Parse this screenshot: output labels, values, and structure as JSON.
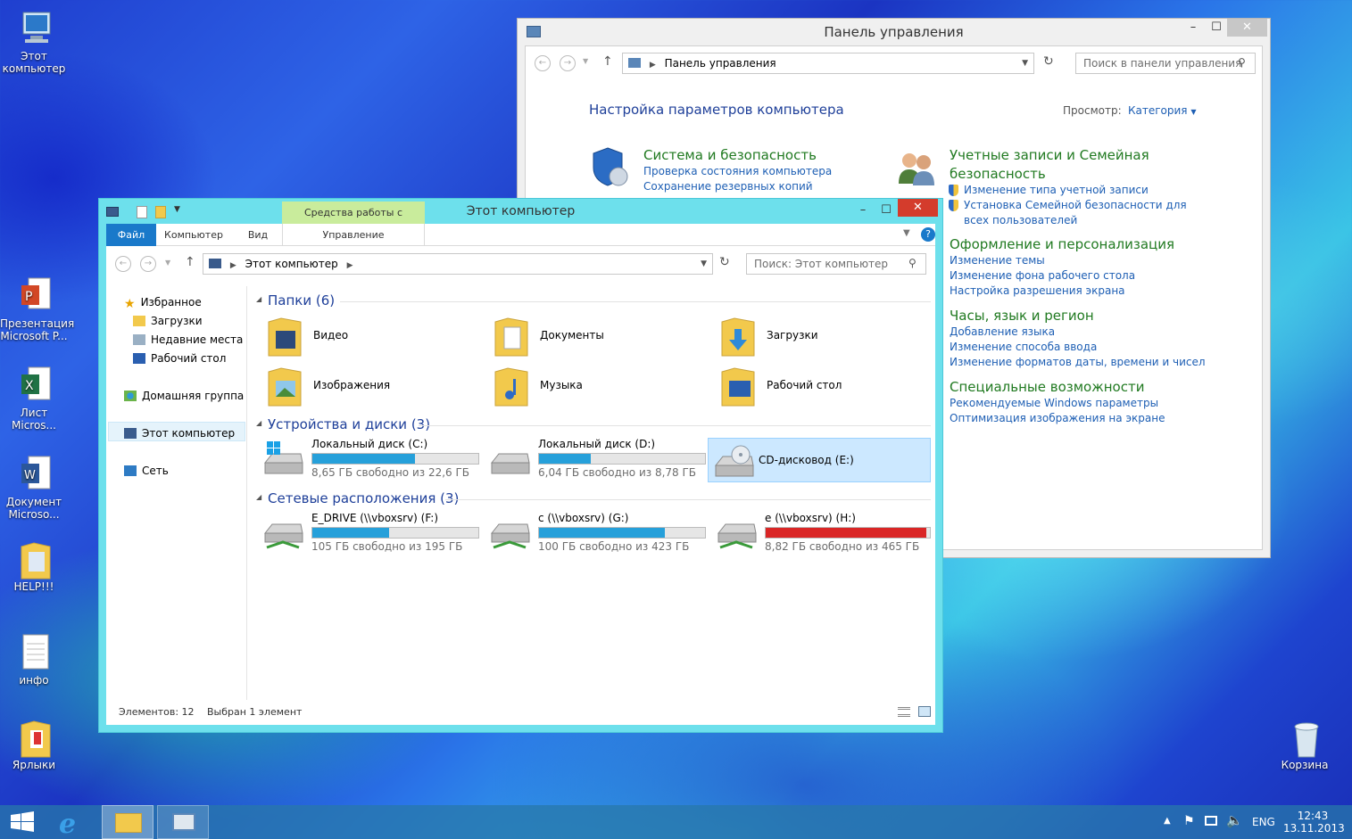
{
  "desktop": {
    "icons": [
      {
        "label": "Этот компьютер"
      },
      {
        "label": "Презентация Microsoft P..."
      },
      {
        "label": "Лист Micros..."
      },
      {
        "label": "Документ Microso..."
      },
      {
        "label": "HELP!!!"
      },
      {
        "label": "инфо"
      },
      {
        "label": "Ярлыки"
      },
      {
        "label": "Корзина"
      }
    ]
  },
  "control_panel": {
    "title": "Панель управления",
    "address": "Панель управления",
    "search_placeholder": "Поиск в панели управления",
    "heading": "Настройка параметров компьютера",
    "view_label": "Просмотр:",
    "view_value": "Категория",
    "categories": [
      {
        "title": "Система и безопасность",
        "links": [
          "Проверка состояния компьютера",
          "Сохранение резервных копий файлов с помощью истории файлов"
        ]
      },
      {
        "title": "Учетные записи и Семейная безопасность",
        "links": [
          "Изменение типа учетной записи",
          "Установка Семейной безопасности для всех пользователей"
        ]
      },
      {
        "title": "Оформление и персонализация",
        "links": [
          "Изменение темы",
          "Изменение фона рабочего стола",
          "Настройка разрешения экрана"
        ]
      },
      {
        "title": "Часы, язык и регион",
        "links": [
          "Добавление языка",
          "Изменение способа ввода",
          "Изменение форматов даты, времени и чисел"
        ]
      },
      {
        "title": "Специальные возможности",
        "links": [
          "Рекомендуемые Windows параметры",
          "Оптимизация изображения на экране"
        ]
      }
    ]
  },
  "explorer": {
    "title": "Этот компьютер",
    "context_tab": "Средства работы с дисками",
    "tabs": [
      "Файл",
      "Компьютер",
      "Вид",
      "Управление"
    ],
    "address": "Этот компьютер",
    "search_placeholder": "Поиск: Этот компьютер",
    "nav": [
      "Избранное",
      "Загрузки",
      "Недавние места",
      "Рабочий стол",
      "Домашняя группа",
      "Этот компьютер",
      "Сеть"
    ],
    "groups": {
      "folders": "Папки (6)",
      "devices": "Устройства и диски (3)",
      "network": "Сетевые расположения (3)"
    },
    "folders": [
      "Видео",
      "Документы",
      "Загрузки",
      "Изображения",
      "Музыка",
      "Рабочий стол"
    ],
    "drives": [
      {
        "name": "Локальный диск (C:)",
        "free": "8,65 ГБ свободно из 22,6 ГБ",
        "used": 0.62
      },
      {
        "name": "Локальный диск (D:)",
        "free": "6,04 ГБ свободно из 8,78 ГБ",
        "used": 0.31
      },
      {
        "name": "CD-дисковод (E:)"
      }
    ],
    "network": [
      {
        "name": "E_DRIVE (\\\\vboxsrv) (F:)",
        "free": "105 ГБ свободно из 195 ГБ",
        "used": 0.46
      },
      {
        "name": "c (\\\\vboxsrv) (G:)",
        "free": "100 ГБ свободно из 423 ГБ",
        "used": 0.76
      },
      {
        "name": "e (\\\\vboxsrv) (H:)",
        "free": "8,82 ГБ свободно из 465 ГБ",
        "used": 0.98
      }
    ],
    "status": {
      "items": "Элементов: 12",
      "selected": "Выбран 1 элемент"
    }
  },
  "taskbar": {
    "lang": "ENG",
    "time": "12:43",
    "date": "13.11.2013"
  },
  "colors": {
    "explorer_frame": "#6de0ec",
    "link": "#1e5fb4",
    "category": "#217a21",
    "bar_normal": "#26a0da",
    "bar_full": "#da2626"
  }
}
